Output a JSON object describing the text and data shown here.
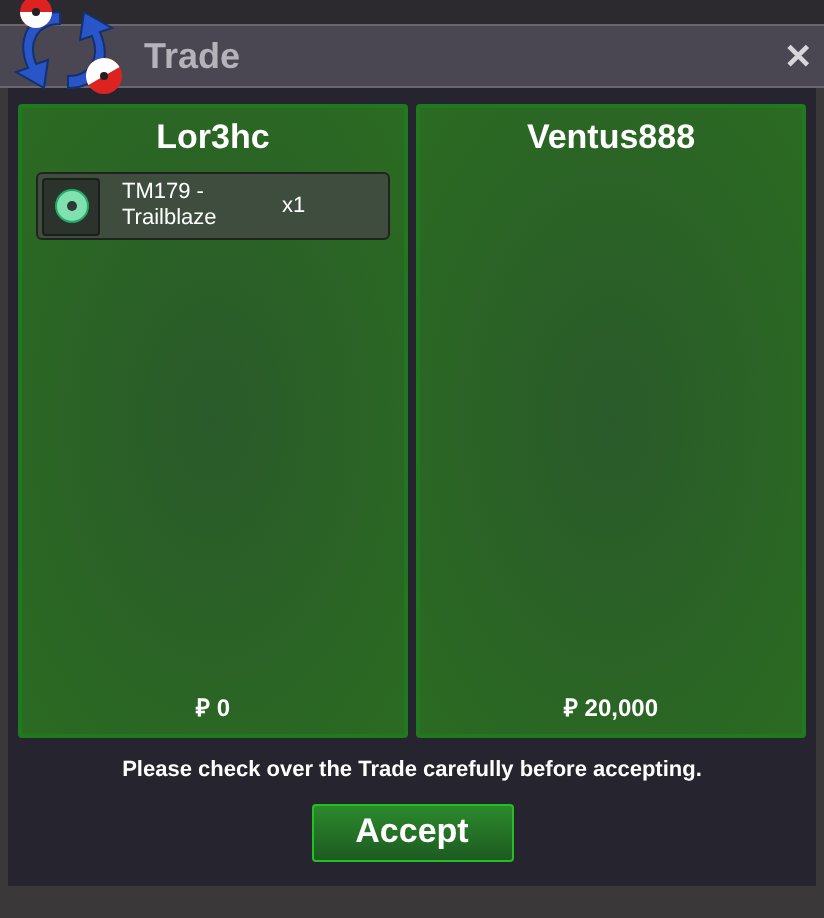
{
  "window": {
    "title": "Trade",
    "close": "✕"
  },
  "panels": [
    {
      "name": "Lor3hc",
      "items": [
        {
          "name": "TM179 - Trailblaze",
          "quantity": "x1"
        }
      ],
      "money": "₽ 0"
    },
    {
      "name": "Ventus888",
      "money": "₽ 20,000"
    }
  ],
  "notice": "Please check over the Trade carefully before accepting.",
  "accept_button": "Accept"
}
